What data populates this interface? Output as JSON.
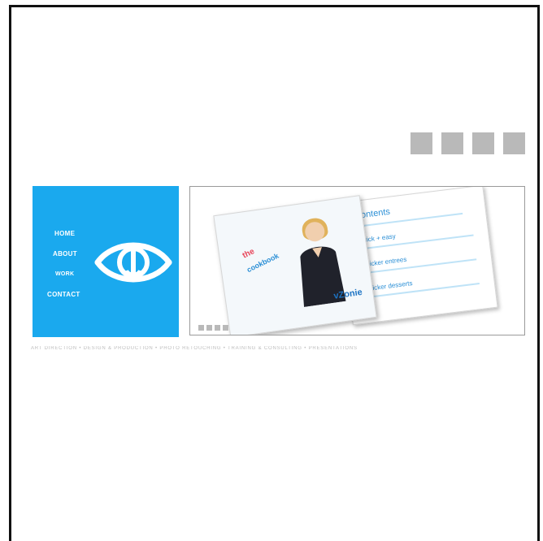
{
  "nav": {
    "items": [
      {
        "label": "HOME"
      },
      {
        "label": "ABOUT"
      },
      {
        "label": "WORK"
      },
      {
        "label": "CONTACT"
      }
    ]
  },
  "showcase": {
    "back_title": "contents",
    "back_rows": [
      "quick + easy",
      "quicker entrees",
      "quicker desserts"
    ],
    "front_title": "the",
    "front_title2": "cookbook",
    "front_brand": "vZonie"
  },
  "services": {
    "text": "ART DIRECTION • DESIGN & PRODUCTION • PHOTO RETOUCHING • TRAINING & CONSULTING • PRESENTATIONS"
  },
  "colors": {
    "accent": "#1aa9ee",
    "thumb": "#b9b9b9"
  },
  "icons": {
    "logo": "eye-logo-icon"
  }
}
